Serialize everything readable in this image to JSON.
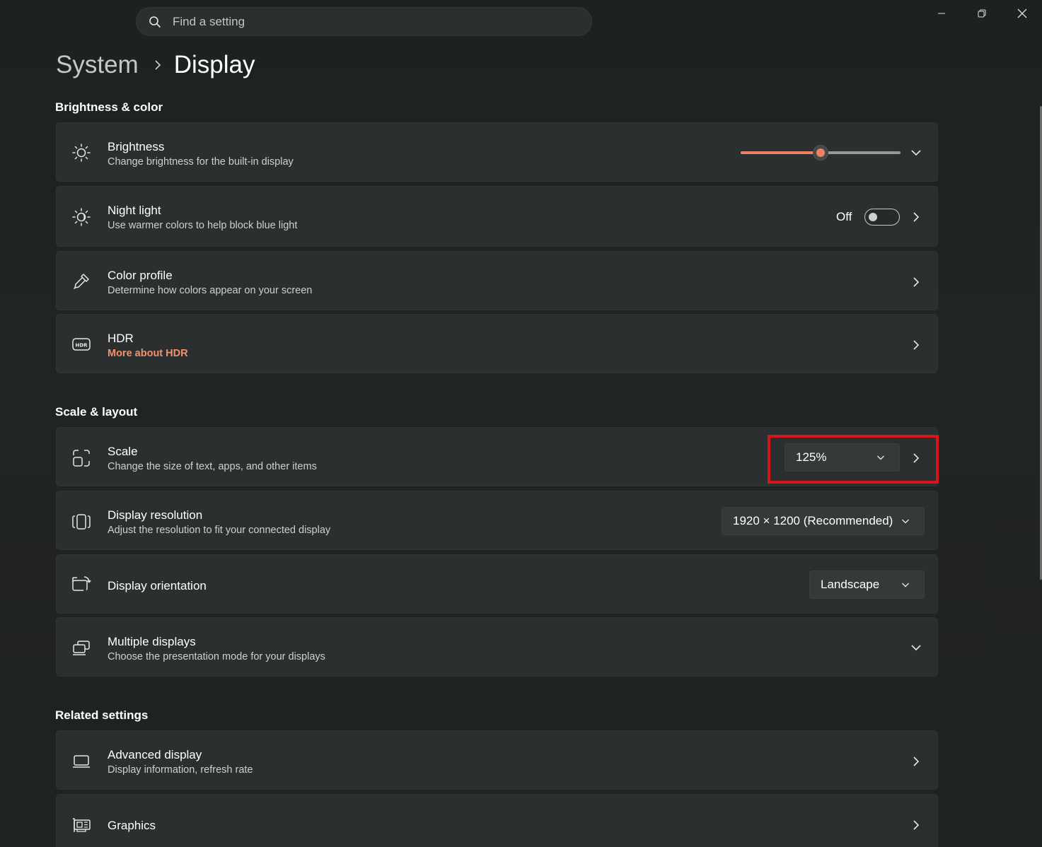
{
  "search": {
    "placeholder": "Find a setting"
  },
  "breadcrumb": {
    "parent": "System",
    "current": "Display"
  },
  "sections": {
    "brightness_color": "Brightness & color",
    "scale_layout": "Scale & layout",
    "related": "Related settings"
  },
  "brightness": {
    "title": "Brightness",
    "desc": "Change brightness for the built-in display",
    "level_percent": 50
  },
  "night_light": {
    "title": "Night light",
    "desc": "Use warmer colors to help block blue light",
    "state": "Off"
  },
  "color_profile": {
    "title": "Color profile",
    "desc": "Determine how colors appear on your screen"
  },
  "hdr": {
    "title": "HDR",
    "link": "More about HDR"
  },
  "scale": {
    "title": "Scale",
    "desc": "Change the size of text, apps, and other items",
    "value": "125%"
  },
  "resolution": {
    "title": "Display resolution",
    "desc": "Adjust the resolution to fit your connected display",
    "value": "1920 × 1200 (Recommended)"
  },
  "orientation": {
    "title": "Display orientation",
    "value": "Landscape"
  },
  "multiple": {
    "title": "Multiple displays",
    "desc": "Choose the presentation mode for your displays"
  },
  "advanced": {
    "title": "Advanced display",
    "desc": "Display information, refresh rate"
  },
  "graphics": {
    "title": "Graphics"
  },
  "colors": {
    "accent": "#f0826a",
    "link": "#f0926a",
    "highlight": "#d9141b"
  }
}
